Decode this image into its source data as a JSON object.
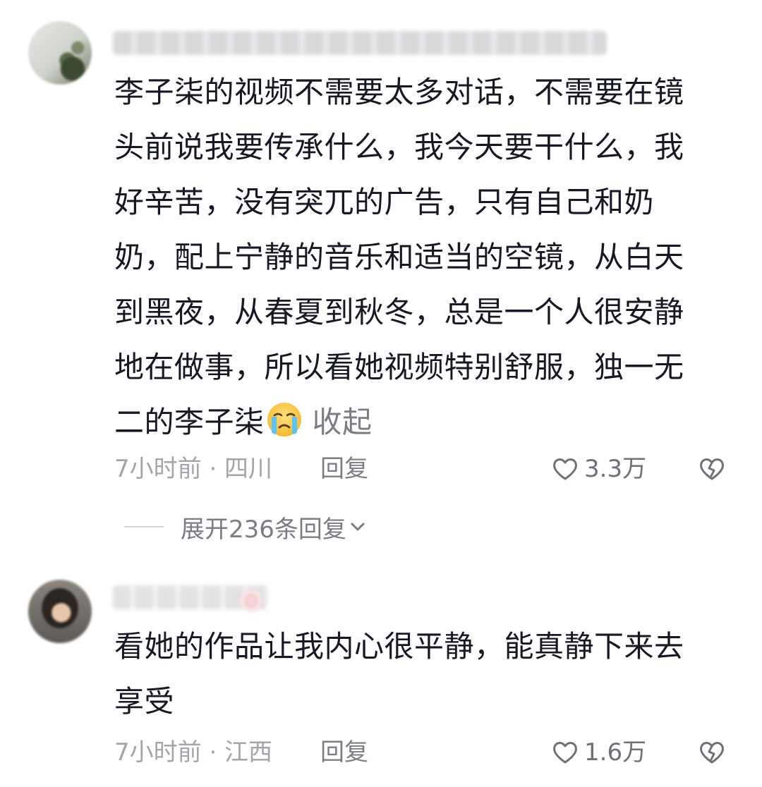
{
  "comments": [
    {
      "text_lines": [
        "李子柒的视频不需要太多对话，不需要在镜",
        "头前说我要传承什么，我今天要干什么，我",
        "好辛苦，没有突兀的广告，只有自己和奶",
        "奶，配上宁静的音乐和适当的空镜，从白天",
        "到黑夜，从春夏到秋冬，总是一个人很安静",
        "地在做事，所以看她视频特别舒服，独一无",
        "二的李子柒"
      ],
      "emoji": "crying-face-icon",
      "collapse_label": "收起",
      "meta": "7小时前 · 四川",
      "reply_label": "回复",
      "likes": "3.3万",
      "expand_label": "展开236条回复"
    },
    {
      "text_lines": [
        "看她的作品让我内心很平静，能真静下来去",
        "享受"
      ],
      "meta": "7小时前 · 江西",
      "reply_label": "回复",
      "likes": "1.6万"
    }
  ],
  "icons": {
    "like": "heart-outline-icon",
    "dislike": "broken-heart-icon",
    "expand": "chevron-down-icon"
  },
  "colors": {
    "text": "#161823",
    "meta": "#a4a5aa",
    "secondary": "#7b7d84"
  }
}
